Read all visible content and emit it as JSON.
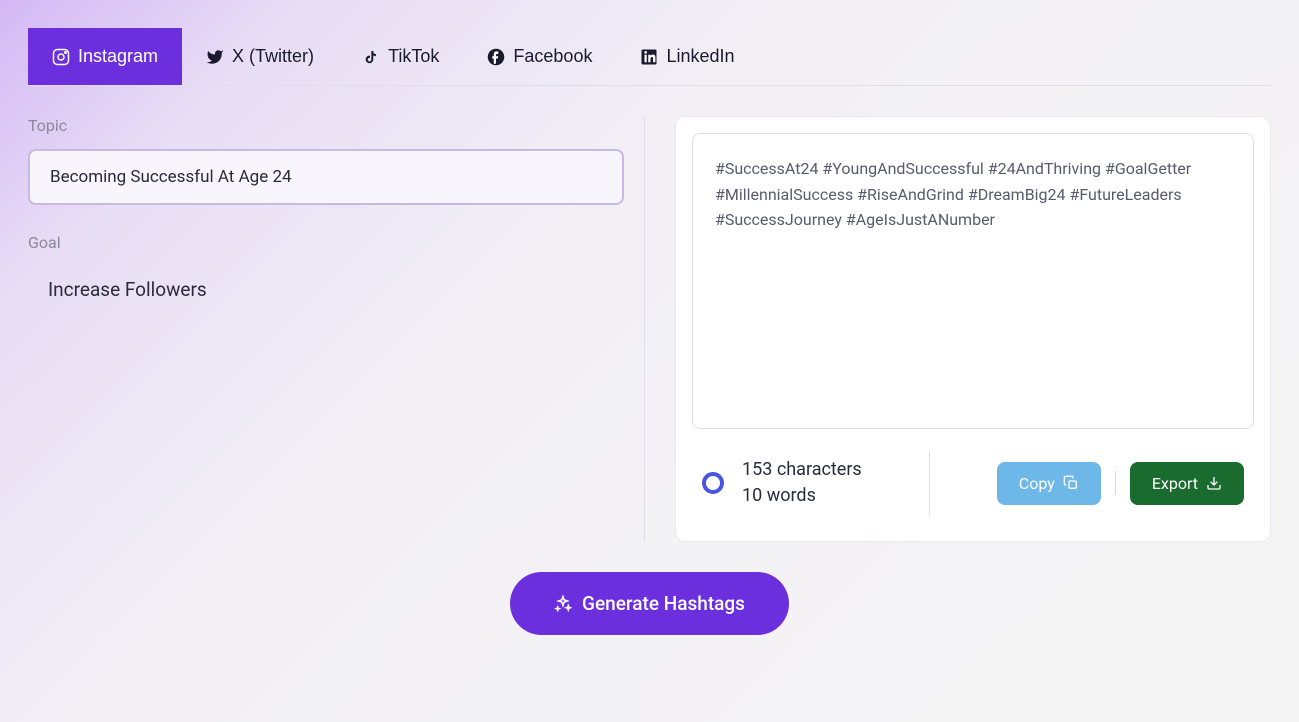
{
  "tabs": [
    {
      "label": "Instagram",
      "icon": "instagram",
      "active": true
    },
    {
      "label": "X (Twitter)",
      "icon": "twitter",
      "active": false
    },
    {
      "label": "TikTok",
      "icon": "tiktok",
      "active": false
    },
    {
      "label": "Facebook",
      "icon": "facebook",
      "active": false
    },
    {
      "label": "LinkedIn",
      "icon": "linkedin",
      "active": false
    }
  ],
  "form": {
    "topic_label": "Topic",
    "topic_value": "Becoming Successful At Age 24",
    "goal_label": "Goal",
    "goal_value": "Increase Followers"
  },
  "output": {
    "text": "#SuccessAt24 #YoungAndSuccessful #24AndThriving #GoalGetter #MillennialSuccess #RiseAndGrind #DreamBig24 #FutureLeaders #SuccessJourney #AgeIsJustANumber",
    "chars_line": "153 characters",
    "words_line": "10 words"
  },
  "buttons": {
    "copy": "Copy",
    "export": "Export",
    "generate": "Generate Hashtags"
  }
}
